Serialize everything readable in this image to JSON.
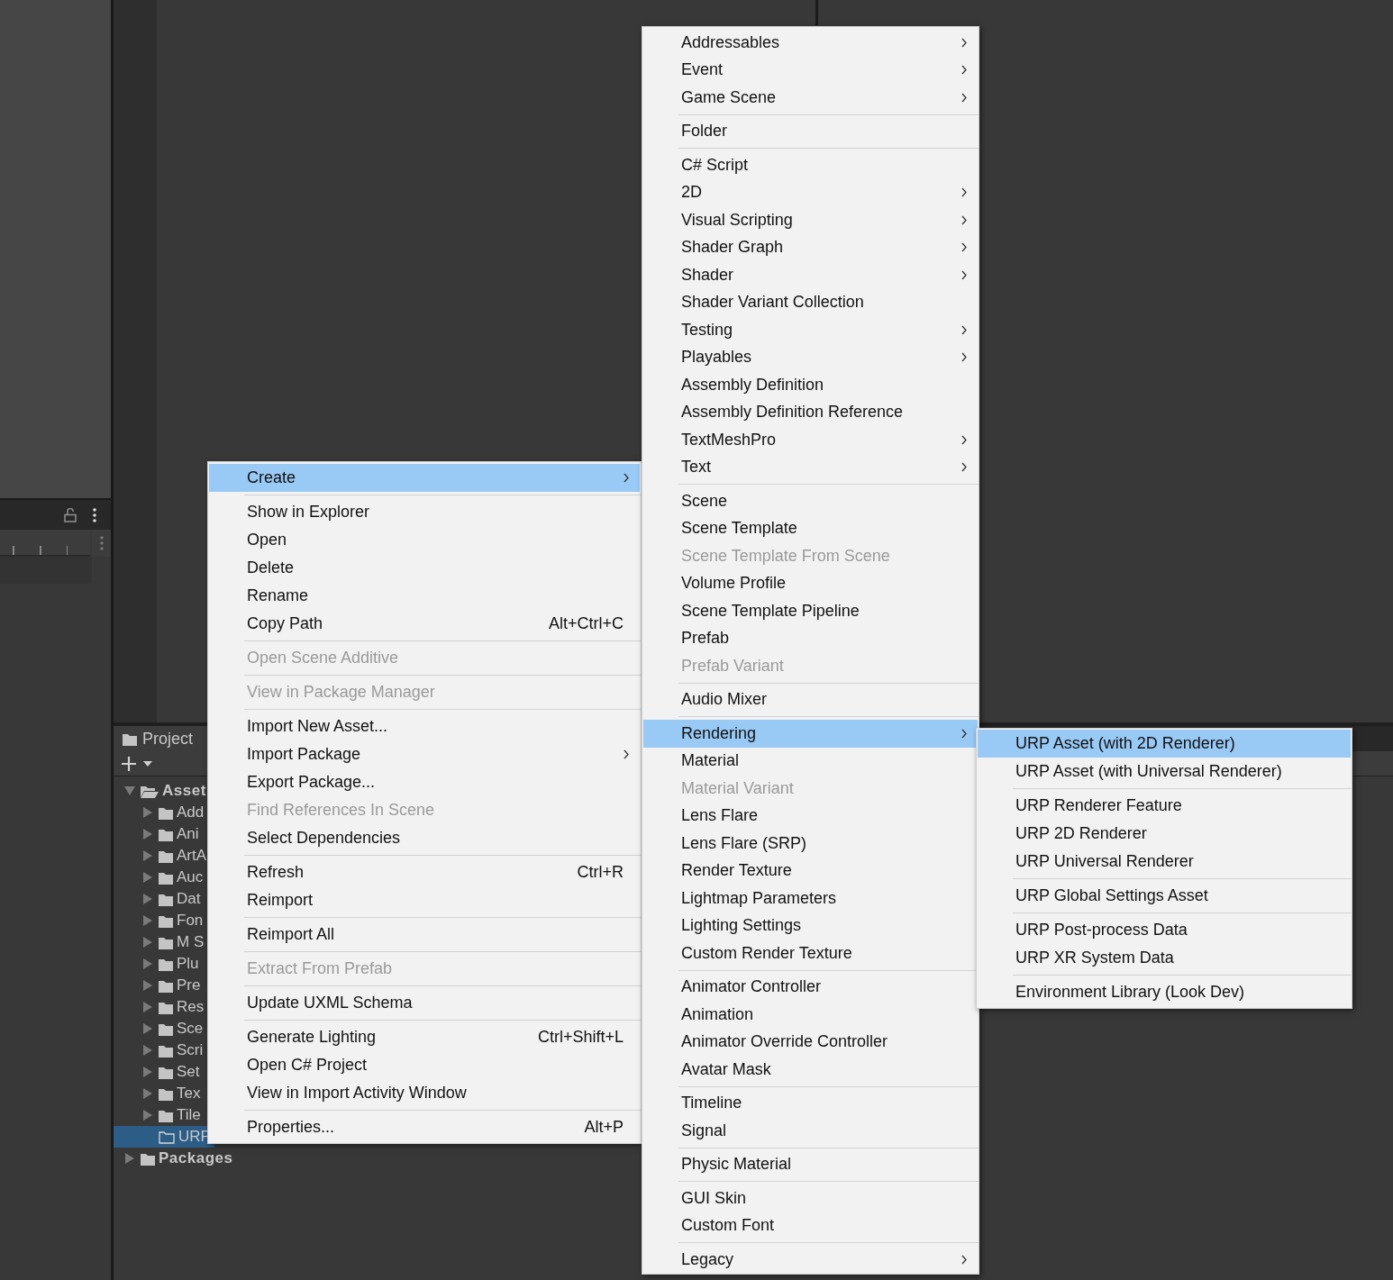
{
  "project": {
    "tab": "Project",
    "tree": [
      {
        "label": "Asset",
        "expandable": true,
        "expanded": true,
        "selected": false,
        "children": [
          {
            "label": "Add",
            "expandable": true,
            "expanded": false,
            "selected": false
          },
          {
            "label": "Ani",
            "expandable": true,
            "expanded": false,
            "selected": false
          },
          {
            "label": "ArtA",
            "expandable": true,
            "expanded": false,
            "selected": false
          },
          {
            "label": "Auc",
            "expandable": true,
            "expanded": false,
            "selected": false
          },
          {
            "label": "Dat",
            "expandable": true,
            "expanded": false,
            "selected": false
          },
          {
            "label": "Fon",
            "expandable": true,
            "expanded": false,
            "selected": false
          },
          {
            "label": "M S",
            "expandable": true,
            "expanded": false,
            "selected": false
          },
          {
            "label": "Plu",
            "expandable": true,
            "expanded": false,
            "selected": false
          },
          {
            "label": "Pre",
            "expandable": true,
            "expanded": false,
            "selected": false
          },
          {
            "label": "Res",
            "expandable": true,
            "expanded": false,
            "selected": false
          },
          {
            "label": "Sce",
            "expandable": true,
            "expanded": false,
            "selected": false
          },
          {
            "label": "Scri",
            "expandable": true,
            "expanded": false,
            "selected": false
          },
          {
            "label": "Set",
            "expandable": true,
            "expanded": false,
            "selected": false
          },
          {
            "label": "Tex",
            "expandable": true,
            "expanded": false,
            "selected": false
          },
          {
            "label": "Tile",
            "expandable": true,
            "expanded": false,
            "selected": false
          },
          {
            "label": "URP",
            "expandable": false,
            "expanded": false,
            "selected": true
          }
        ]
      },
      {
        "label": "Packages",
        "expandable": true,
        "expanded": false,
        "selected": false
      }
    ]
  },
  "menus": [
    {
      "items": [
        {
          "kind": "item",
          "label": "Create",
          "submenu": true,
          "disabled": false,
          "selected": true
        },
        {
          "kind": "separator"
        },
        {
          "kind": "item",
          "label": "Show in Explorer",
          "submenu": false,
          "disabled": false,
          "selected": false
        },
        {
          "kind": "item",
          "label": "Open",
          "submenu": false,
          "disabled": false,
          "selected": false
        },
        {
          "kind": "item",
          "label": "Delete",
          "submenu": false,
          "disabled": false,
          "selected": false
        },
        {
          "kind": "item",
          "label": "Rename",
          "submenu": false,
          "disabled": false,
          "selected": false
        },
        {
          "kind": "item",
          "label": "Copy Path",
          "shortcut": "Alt+Ctrl+C",
          "submenu": false,
          "disabled": false,
          "selected": false
        },
        {
          "kind": "separator"
        },
        {
          "kind": "item",
          "label": "Open Scene Additive",
          "submenu": false,
          "disabled": true,
          "selected": false
        },
        {
          "kind": "separator"
        },
        {
          "kind": "item",
          "label": "View in Package Manager",
          "submenu": false,
          "disabled": true,
          "selected": false
        },
        {
          "kind": "separator"
        },
        {
          "kind": "item",
          "label": "Import New Asset...",
          "submenu": false,
          "disabled": false,
          "selected": false
        },
        {
          "kind": "item",
          "label": "Import Package",
          "submenu": true,
          "disabled": false,
          "selected": false
        },
        {
          "kind": "item",
          "label": "Export Package...",
          "submenu": false,
          "disabled": false,
          "selected": false
        },
        {
          "kind": "item",
          "label": "Find References In Scene",
          "submenu": false,
          "disabled": true,
          "selected": false
        },
        {
          "kind": "item",
          "label": "Select Dependencies",
          "submenu": false,
          "disabled": false,
          "selected": false
        },
        {
          "kind": "separator"
        },
        {
          "kind": "item",
          "label": "Refresh",
          "shortcut": "Ctrl+R",
          "submenu": false,
          "disabled": false,
          "selected": false
        },
        {
          "kind": "item",
          "label": "Reimport",
          "submenu": false,
          "disabled": false,
          "selected": false
        },
        {
          "kind": "separator"
        },
        {
          "kind": "item",
          "label": "Reimport All",
          "submenu": false,
          "disabled": false,
          "selected": false
        },
        {
          "kind": "separator"
        },
        {
          "kind": "item",
          "label": "Extract From Prefab",
          "submenu": false,
          "disabled": true,
          "selected": false
        },
        {
          "kind": "separator"
        },
        {
          "kind": "item",
          "label": "Update UXML Schema",
          "submenu": false,
          "disabled": false,
          "selected": false
        },
        {
          "kind": "separator"
        },
        {
          "kind": "item",
          "label": "Generate Lighting",
          "shortcut": "Ctrl+Shift+L",
          "submenu": false,
          "disabled": false,
          "selected": false
        },
        {
          "kind": "item",
          "label": "Open C# Project",
          "submenu": false,
          "disabled": false,
          "selected": false
        },
        {
          "kind": "item",
          "label": "View in Import Activity Window",
          "submenu": false,
          "disabled": false,
          "selected": false
        },
        {
          "kind": "separator"
        },
        {
          "kind": "item",
          "label": "Properties...",
          "shortcut": "Alt+P",
          "submenu": false,
          "disabled": false,
          "selected": false
        }
      ]
    },
    {
      "items": [
        {
          "kind": "item",
          "label": "Addressables",
          "submenu": true,
          "disabled": false,
          "selected": false
        },
        {
          "kind": "item",
          "label": "Event",
          "submenu": true,
          "disabled": false,
          "selected": false
        },
        {
          "kind": "item",
          "label": "Game Scene",
          "submenu": true,
          "disabled": false,
          "selected": false
        },
        {
          "kind": "separator"
        },
        {
          "kind": "item",
          "label": "Folder",
          "submenu": false,
          "disabled": false,
          "selected": false
        },
        {
          "kind": "separator"
        },
        {
          "kind": "item",
          "label": "C# Script",
          "submenu": false,
          "disabled": false,
          "selected": false
        },
        {
          "kind": "item",
          "label": "2D",
          "submenu": true,
          "disabled": false,
          "selected": false
        },
        {
          "kind": "item",
          "label": "Visual Scripting",
          "submenu": true,
          "disabled": false,
          "selected": false
        },
        {
          "kind": "item",
          "label": "Shader Graph",
          "submenu": true,
          "disabled": false,
          "selected": false
        },
        {
          "kind": "item",
          "label": "Shader",
          "submenu": true,
          "disabled": false,
          "selected": false
        },
        {
          "kind": "item",
          "label": "Shader Variant Collection",
          "submenu": false,
          "disabled": false,
          "selected": false
        },
        {
          "kind": "item",
          "label": "Testing",
          "submenu": true,
          "disabled": false,
          "selected": false
        },
        {
          "kind": "item",
          "label": "Playables",
          "submenu": true,
          "disabled": false,
          "selected": false
        },
        {
          "kind": "item",
          "label": "Assembly Definition",
          "submenu": false,
          "disabled": false,
          "selected": false
        },
        {
          "kind": "item",
          "label": "Assembly Definition Reference",
          "submenu": false,
          "disabled": false,
          "selected": false
        },
        {
          "kind": "item",
          "label": "TextMeshPro",
          "submenu": true,
          "disabled": false,
          "selected": false
        },
        {
          "kind": "item",
          "label": "Text",
          "submenu": true,
          "disabled": false,
          "selected": false
        },
        {
          "kind": "separator"
        },
        {
          "kind": "item",
          "label": "Scene",
          "submenu": false,
          "disabled": false,
          "selected": false
        },
        {
          "kind": "item",
          "label": "Scene Template",
          "submenu": false,
          "disabled": false,
          "selected": false
        },
        {
          "kind": "item",
          "label": "Scene Template From Scene",
          "submenu": false,
          "disabled": true,
          "selected": false
        },
        {
          "kind": "item",
          "label": "Volume Profile",
          "submenu": false,
          "disabled": false,
          "selected": false
        },
        {
          "kind": "item",
          "label": "Scene Template Pipeline",
          "submenu": false,
          "disabled": false,
          "selected": false
        },
        {
          "kind": "item",
          "label": "Prefab",
          "submenu": false,
          "disabled": false,
          "selected": false
        },
        {
          "kind": "item",
          "label": "Prefab Variant",
          "submenu": false,
          "disabled": true,
          "selected": false
        },
        {
          "kind": "separator"
        },
        {
          "kind": "item",
          "label": "Audio Mixer",
          "submenu": false,
          "disabled": false,
          "selected": false
        },
        {
          "kind": "separator"
        },
        {
          "kind": "item",
          "label": "Rendering",
          "submenu": true,
          "disabled": false,
          "selected": true
        },
        {
          "kind": "item",
          "label": "Material",
          "submenu": false,
          "disabled": false,
          "selected": false
        },
        {
          "kind": "item",
          "label": "Material Variant",
          "submenu": false,
          "disabled": true,
          "selected": false
        },
        {
          "kind": "item",
          "label": "Lens Flare",
          "submenu": false,
          "disabled": false,
          "selected": false
        },
        {
          "kind": "item",
          "label": "Lens Flare (SRP)",
          "submenu": false,
          "disabled": false,
          "selected": false
        },
        {
          "kind": "item",
          "label": "Render Texture",
          "submenu": false,
          "disabled": false,
          "selected": false
        },
        {
          "kind": "item",
          "label": "Lightmap Parameters",
          "submenu": false,
          "disabled": false,
          "selected": false
        },
        {
          "kind": "item",
          "label": "Lighting Settings",
          "submenu": false,
          "disabled": false,
          "selected": false
        },
        {
          "kind": "item",
          "label": "Custom Render Texture",
          "submenu": false,
          "disabled": false,
          "selected": false
        },
        {
          "kind": "separator"
        },
        {
          "kind": "item",
          "label": "Animator Controller",
          "submenu": false,
          "disabled": false,
          "selected": false
        },
        {
          "kind": "item",
          "label": "Animation",
          "submenu": false,
          "disabled": false,
          "selected": false
        },
        {
          "kind": "item",
          "label": "Animator Override Controller",
          "submenu": false,
          "disabled": false,
          "selected": false
        },
        {
          "kind": "item",
          "label": "Avatar Mask",
          "submenu": false,
          "disabled": false,
          "selected": false
        },
        {
          "kind": "separator"
        },
        {
          "kind": "item",
          "label": "Timeline",
          "submenu": false,
          "disabled": false,
          "selected": false
        },
        {
          "kind": "item",
          "label": "Signal",
          "submenu": false,
          "disabled": false,
          "selected": false
        },
        {
          "kind": "separator"
        },
        {
          "kind": "item",
          "label": "Physic Material",
          "submenu": false,
          "disabled": false,
          "selected": false
        },
        {
          "kind": "separator"
        },
        {
          "kind": "item",
          "label": "GUI Skin",
          "submenu": false,
          "disabled": false,
          "selected": false
        },
        {
          "kind": "item",
          "label": "Custom Font",
          "submenu": false,
          "disabled": false,
          "selected": false
        },
        {
          "kind": "separator"
        },
        {
          "kind": "item",
          "label": "Legacy",
          "submenu": true,
          "disabled": false,
          "selected": false
        }
      ]
    },
    {
      "items": [
        {
          "kind": "item",
          "label": "URP Asset (with 2D Renderer)",
          "submenu": false,
          "disabled": false,
          "selected": true
        },
        {
          "kind": "item",
          "label": "URP Asset (with Universal Renderer)",
          "submenu": false,
          "disabled": false,
          "selected": false
        },
        {
          "kind": "separator"
        },
        {
          "kind": "item",
          "label": "URP Renderer Feature",
          "submenu": false,
          "disabled": false,
          "selected": false
        },
        {
          "kind": "item",
          "label": "URP 2D Renderer",
          "submenu": false,
          "disabled": false,
          "selected": false
        },
        {
          "kind": "item",
          "label": "URP Universal Renderer",
          "submenu": false,
          "disabled": false,
          "selected": false
        },
        {
          "kind": "separator"
        },
        {
          "kind": "item",
          "label": "URP Global Settings Asset",
          "submenu": false,
          "disabled": false,
          "selected": false
        },
        {
          "kind": "separator"
        },
        {
          "kind": "item",
          "label": "URP Post-process Data",
          "submenu": false,
          "disabled": false,
          "selected": false
        },
        {
          "kind": "item",
          "label": "URP XR System Data",
          "submenu": false,
          "disabled": false,
          "selected": false
        },
        {
          "kind": "separator"
        },
        {
          "kind": "item",
          "label": "Environment Library (Look Dev)",
          "submenu": false,
          "disabled": false,
          "selected": false
        }
      ]
    }
  ]
}
